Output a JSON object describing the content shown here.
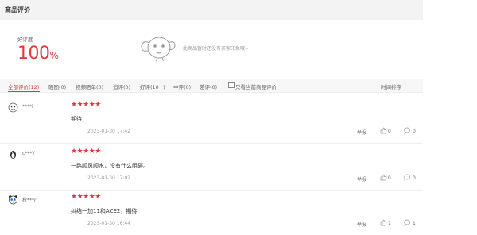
{
  "header": {
    "title": "商品评价"
  },
  "summary": {
    "rate_label": "好评度",
    "rate_value": "100",
    "rate_unit": "%",
    "no_tags_text": "此商品暂时还没有买家印象哦~"
  },
  "filters": {
    "items": [
      {
        "label": "全部评价(12)",
        "active": true
      },
      {
        "label": "晒图(0)"
      },
      {
        "label": "视频晒单(0)"
      },
      {
        "label": "追评(0)"
      },
      {
        "label": "好评(10+)"
      },
      {
        "label": "中评(0)"
      },
      {
        "label": "差评(0)"
      }
    ],
    "only_current_label": "只看当前商品评价",
    "sort_label": "时间排序"
  },
  "reviews": [
    {
      "user": "****i",
      "rating": 5,
      "stars": "★★★★★",
      "content": "期待",
      "time": "2023-01-30 17:42",
      "report": "举报",
      "likes": "0",
      "comments": "0",
      "avatar": "smiley-avatar-icon"
    },
    {
      "user": "c***Y",
      "rating": 5,
      "stars": "★★★★★",
      "content": "一路顺风顺水，没有什么阻碍。",
      "time": "2023-01-30 17:02",
      "report": "举报",
      "likes": "0",
      "comments": "0",
      "avatar": "penguin-avatar-icon"
    },
    {
      "user": "秋***r",
      "rating": 5,
      "stars": "★★★★★",
      "content": "纠结一加11和ACE2，期待",
      "time": "2023-01-30 16:44",
      "report": "举报",
      "likes": "1",
      "comments": "1",
      "avatar": "panda-avatar-icon"
    }
  ],
  "colors": {
    "accent": "#e4393c",
    "header_bg": "#f3f3f3"
  }
}
